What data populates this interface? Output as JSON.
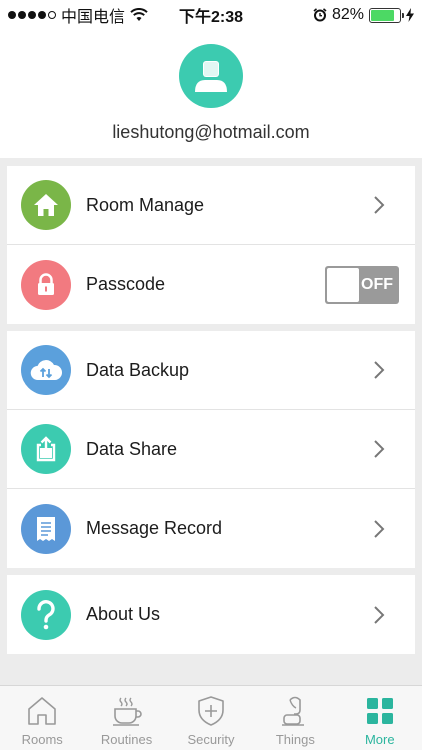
{
  "status_bar": {
    "carrier": "中国电信",
    "time": "下午2:38",
    "battery": "82%",
    "battery_level": 0.82
  },
  "profile": {
    "email": "lieshutong@hotmail.com"
  },
  "groups": [
    {
      "items": [
        {
          "label": "Room Manage",
          "icon": "home-icon",
          "color": "#7ab648"
        },
        {
          "label": "Passcode",
          "icon": "lock-icon",
          "color": "#f27a80",
          "toggle": "OFF"
        }
      ]
    },
    {
      "items": [
        {
          "label": "Data Backup",
          "icon": "cloud-sync-icon",
          "color": "#5ba0dc"
        },
        {
          "label": "Data Share",
          "icon": "share-icon",
          "color": "#3ccbb0"
        },
        {
          "label": "Message Record",
          "icon": "receipt-icon",
          "color": "#5b98d8"
        }
      ]
    },
    {
      "items": [
        {
          "label": "About Us",
          "icon": "question-icon",
          "color": "#3ccbb0"
        }
      ]
    }
  ],
  "tabbar": {
    "tabs": [
      {
        "label": "Rooms",
        "icon": "house-outline-icon"
      },
      {
        "label": "Routines",
        "icon": "cup-icon"
      },
      {
        "label": "Security",
        "icon": "shield-icon"
      },
      {
        "label": "Things",
        "icon": "lamp-icon"
      },
      {
        "label": "More",
        "icon": "grid-icon",
        "active": true
      }
    ]
  },
  "colors": {
    "accent": "#2bb59e",
    "avatar_bg": "#3ccbb0",
    "toggle_off": "#9a9a9a"
  }
}
